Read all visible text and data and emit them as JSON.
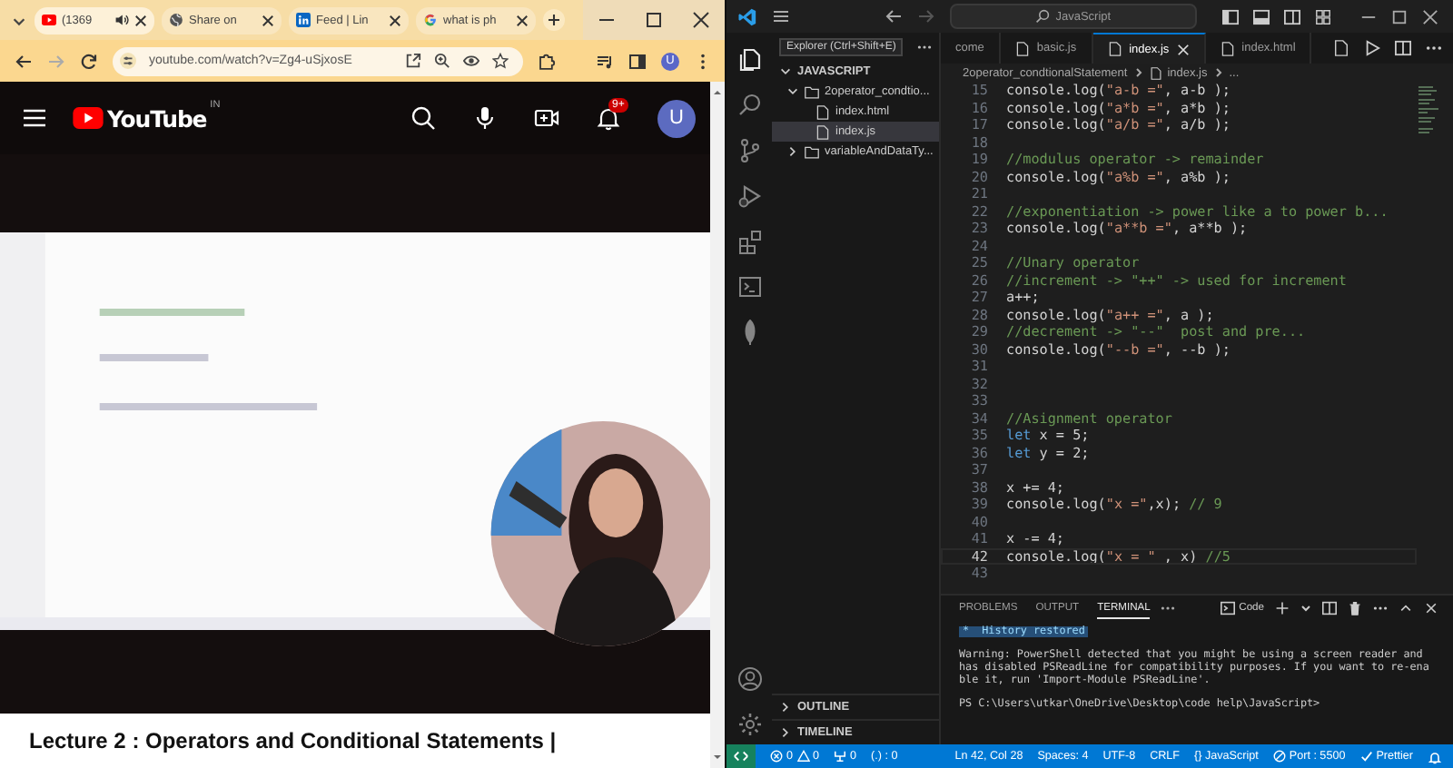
{
  "browser": {
    "tabs": [
      {
        "title": "(1369",
        "kind": "youtube",
        "audio": true,
        "selected": true
      },
      {
        "title": "Share on",
        "kind": "globe",
        "audio": false,
        "selected": false
      },
      {
        "title": "Feed | Lin",
        "kind": "linkedin",
        "audio": false,
        "selected": false
      },
      {
        "title": "what is ph",
        "kind": "google",
        "audio": false,
        "selected": false
      }
    ],
    "url": "youtube.com/watch?v=Zg4-uSjxosE",
    "profile": "U"
  },
  "youtube": {
    "logo": "YouTube",
    "region": "IN",
    "notifications": "9+",
    "avatar": "U",
    "title": "Lecture 2 : Operators and Conditional Statements |"
  },
  "vscode": {
    "search": "JavaScript",
    "explorer_header": "Explorer (Ctrl+Shift+E)",
    "workspace": "JAVASCRIPT",
    "tree": [
      {
        "name": "2operator_condtio...",
        "kind": "folder",
        "expanded": true,
        "selected": false,
        "children": [
          {
            "name": "index.html",
            "kind": "file",
            "selected": false
          },
          {
            "name": "index.js",
            "kind": "file",
            "selected": true
          }
        ]
      },
      {
        "name": "variableAndDataTy...",
        "kind": "folder",
        "expanded": false,
        "selected": false
      }
    ],
    "sections": [
      {
        "label": "OUTLINE",
        "expanded": false
      },
      {
        "label": "TIMELINE",
        "expanded": false
      }
    ],
    "editor_tabs": [
      {
        "label": "come",
        "selected": false
      },
      {
        "label": "basic.js",
        "selected": false
      },
      {
        "label": "index.js",
        "selected": true
      },
      {
        "label": "index.html",
        "selected": false
      }
    ],
    "breadcrumb": [
      "2operator_condtionalStatement",
      "index.js",
      "..."
    ],
    "lines": [
      {
        "n": "15",
        "text": "console.log(\"a-b =\", a-b );",
        "current": false
      },
      {
        "n": "16",
        "text": "console.log(\"a*b =\", a*b );",
        "current": false
      },
      {
        "n": "17",
        "text": "console.log(\"a/b =\", a/b );",
        "current": false
      },
      {
        "n": "18",
        "current": false
      },
      {
        "n": "19",
        "text": "//modulus operator -> remainder",
        "current": false
      },
      {
        "n": "20",
        "text": "console.log(\"a%b =\", a%b );",
        "current": false
      },
      {
        "n": "21",
        "current": false
      },
      {
        "n": "22",
        "text": "//exponentiation -> power like a to power b...",
        "current": false
      },
      {
        "n": "23",
        "text": "console.log(\"a**b =\", a**b );",
        "current": false
      },
      {
        "n": "24",
        "current": false
      },
      {
        "n": "25",
        "text": "//Unary operator",
        "current": false
      },
      {
        "n": "26",
        "text": "//increment -> \"++\" -> used for increment",
        "current": false
      },
      {
        "n": "27",
        "text": "a++;",
        "current": false
      },
      {
        "n": "28",
        "text": "console.log(\"a++ =\", a );",
        "current": false
      },
      {
        "n": "29",
        "text": "//decrement -> \"--\"  post and pre...",
        "current": false
      },
      {
        "n": "30",
        "text": "console.log(\"--b =\", --b );",
        "current": false
      },
      {
        "n": "31",
        "current": false
      },
      {
        "n": "32",
        "current": false
      },
      {
        "n": "33",
        "current": false
      },
      {
        "n": "34",
        "text": "//Asignment operator",
        "current": false
      },
      {
        "n": "35",
        "text": "let x = 5;",
        "current": false
      },
      {
        "n": "36",
        "text": "let y = 2;",
        "current": false
      },
      {
        "n": "37",
        "current": false
      },
      {
        "n": "38",
        "text": "x += 4;",
        "current": false
      },
      {
        "n": "39",
        "text": "console.log(\"x =\",x); // 9",
        "current": false
      },
      {
        "n": "40",
        "current": false
      },
      {
        "n": "41",
        "text": "x -= 4;",
        "current": false
      },
      {
        "n": "42",
        "text": "console.log(\"x = \" , x) //5",
        "current": true
      },
      {
        "n": "43",
        "current": false
      }
    ],
    "panel_tabs": [
      {
        "label": "PROBLEMS",
        "selected": false
      },
      {
        "label": "OUTPUT",
        "selected": false
      },
      {
        "label": "TERMINAL",
        "selected": true
      }
    ],
    "terminal_profile": "Code",
    "terminal": [
      {
        "kind": "banner",
        "text": "*  History restored"
      },
      {
        "kind": "text",
        "text": "Warning: PowerShell detected that you might be using a screen reader and has disabled PSReadLine for compatibility purposes. If you want to re-enable it, run 'Import-Module PSReadLine'."
      },
      {
        "kind": "text",
        "text": "PS C:\\Users\\utkar\\OneDrive\\Desktop\\code help\\JavaScript>"
      }
    ],
    "status": {
      "errors": "0",
      "warnings": "0",
      "ports": "0",
      "info": "(.) : 0",
      "position": "Ln 42, Col 28",
      "spaces": "Spaces: 4",
      "encoding": "UTF-8",
      "eol": "CRLF",
      "language": "{} JavaScript",
      "port": "Port : 5500",
      "formatter": "Prettier"
    }
  }
}
